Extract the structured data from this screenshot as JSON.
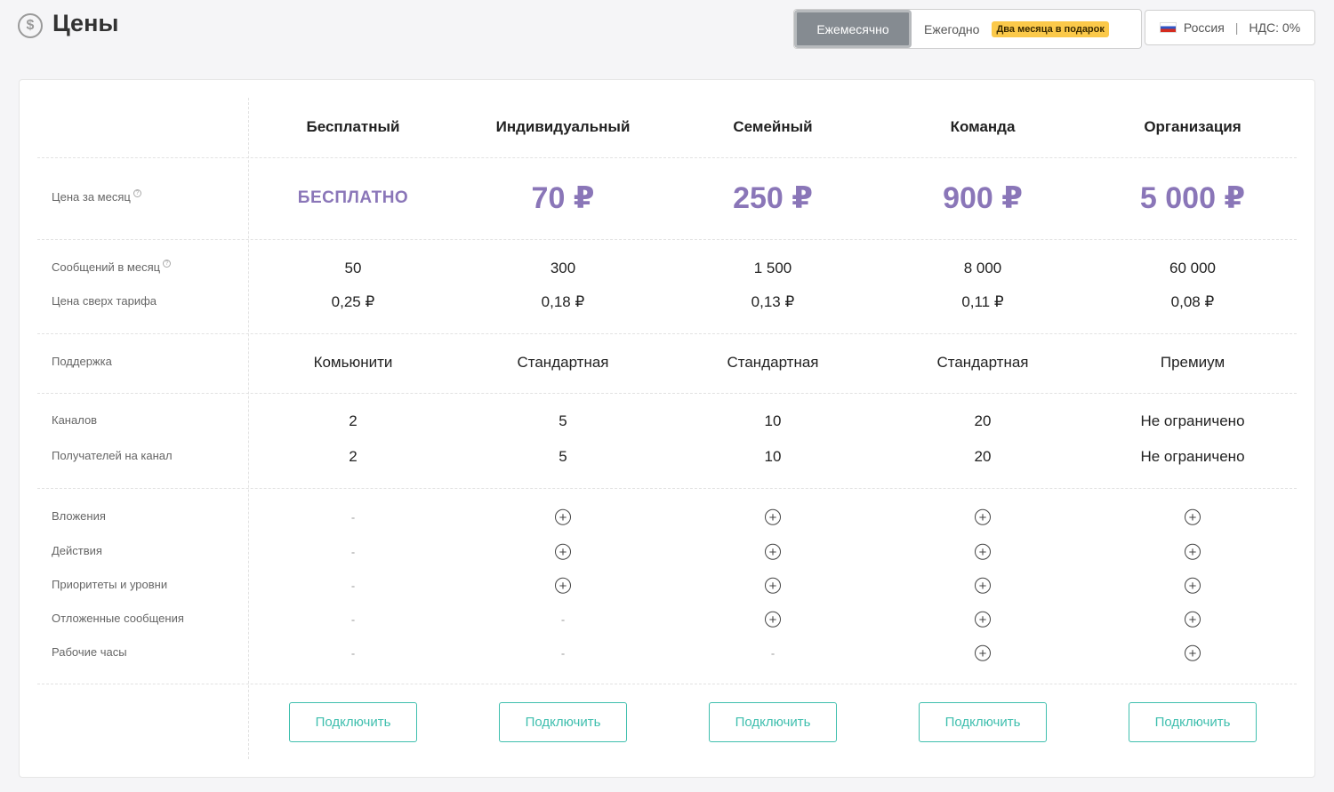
{
  "header": {
    "title": "Цены",
    "toggle": {
      "monthly_label": "Ежемесячно",
      "yearly_label": "Ежегодно",
      "yearly_badge": "Два месяца в подарок"
    },
    "region": {
      "country": "Россия",
      "vat": "НДС: 0%"
    }
  },
  "plans": [
    {
      "name": "Бесплатный",
      "price": "БЕСПЛАТНО",
      "messages": "50",
      "overage": "0,25 ₽",
      "support": "Комьюнити",
      "channels": "2",
      "recipients": "2",
      "features": [
        "-",
        "-",
        "-",
        "-",
        "-"
      ],
      "button": "Подключить"
    },
    {
      "name": "Индивидуальный",
      "price": "70 ₽",
      "messages": "300",
      "overage": "0,18 ₽",
      "support": "Стандартная",
      "channels": "5",
      "recipients": "5",
      "features": [
        "+",
        "+",
        "+",
        "-",
        "-"
      ],
      "button": "Подключить"
    },
    {
      "name": "Семейный",
      "price": "250 ₽",
      "messages": "1 500",
      "overage": "0,13 ₽",
      "support": "Стандартная",
      "channels": "10",
      "recipients": "10",
      "features": [
        "+",
        "+",
        "+",
        "+",
        "-"
      ],
      "button": "Подключить"
    },
    {
      "name": "Команда",
      "price": "900 ₽",
      "messages": "8 000",
      "overage": "0,11 ₽",
      "support": "Стандартная",
      "channels": "20",
      "recipients": "20",
      "features": [
        "+",
        "+",
        "+",
        "+",
        "+"
      ],
      "button": "Подключить"
    },
    {
      "name": "Организация",
      "price": "5 000 ₽",
      "messages": "60 000",
      "overage": "0,08 ₽",
      "support": "Премиум",
      "channels": "Не ограничено",
      "recipients": "Не ограничено",
      "features": [
        "+",
        "+",
        "+",
        "+",
        "+"
      ],
      "button": "Подключить"
    }
  ],
  "labels": {
    "price": "Цена за месяц",
    "messages": "Сообщений в месяц",
    "overage": "Цена сверх тарифа",
    "support": "Поддержка",
    "channels": "Каналов",
    "recipients": "Получателей на канал",
    "features": [
      "Вложения",
      "Действия",
      "Приоритеты и уровни",
      "Отложенные сообщения",
      "Рабочие часы"
    ]
  },
  "icons": {
    "page": "dollar-circle-icon",
    "included": "plus-circle-icon",
    "flag": "russia-flag-icon"
  },
  "colors": {
    "price": "#8a76b8",
    "button": "#3fbfae",
    "badge": "#fbc94a",
    "toggle_active": "#858b91"
  }
}
